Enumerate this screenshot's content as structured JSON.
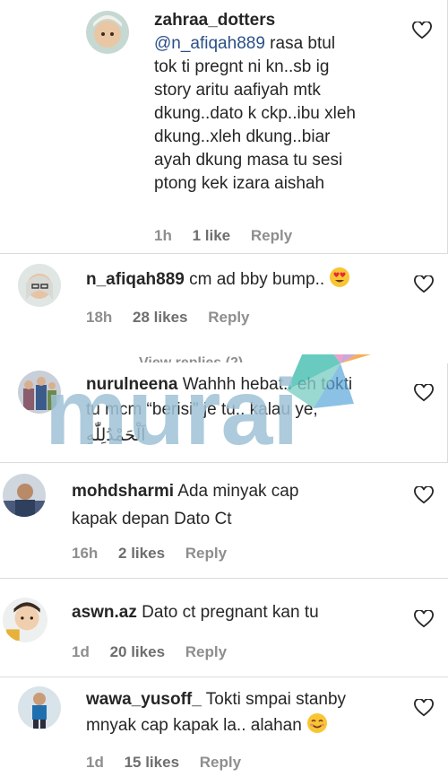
{
  "comments": [
    {
      "username": "zahraa_dotters",
      "mention": "@n_afiqah889",
      "lines": [
        "rasa btul",
        "tok ti pregnt ni kn..sb ig",
        "story aritu aafiyah mtk",
        "dkung..dato k ckp..ibu xleh",
        "dkung..xleh dkung..biar",
        "ayah dkung masa tu sesi",
        "ptong kek izara aishah"
      ],
      "time": "1h",
      "likes": "1 like",
      "reply": "Reply"
    },
    {
      "username": "n_afiqah889",
      "text": "cm ad bby bump..",
      "emoji": "heart-eyes-emoji",
      "time": "18h",
      "likes": "28 likes",
      "reply": "Reply",
      "view_replies": "View replies (2)"
    },
    {
      "username": "nurulneena",
      "text_line1": "Wahhh hebat.. eh tokti",
      "text_line2": "tu mcm “berisi” je tu.. kalau ye,",
      "text_line3": "اَلْحَمْدُلِلّٰهِ"
    },
    {
      "username": "mohdsharmi",
      "text_line1": "Ada minyak cap",
      "text_line2": "kapak depan Dato Ct",
      "time": "16h",
      "likes": "2 likes",
      "reply": "Reply"
    },
    {
      "username": "aswn.az",
      "text": "Dato ct pregnant kan tu",
      "time": "1d",
      "likes": "20 likes",
      "reply": "Reply"
    },
    {
      "username": "wawa_yusoff_",
      "text_line1": "Tokti smpai stanby",
      "text_line2": "mnyak cap kapak la.. alahan",
      "emoji": "smiling-emoji",
      "time": "1d",
      "likes": "15 likes",
      "reply": "Reply"
    }
  ],
  "watermark": {
    "text": "murai",
    "colors": {
      "text": "#9fc3d6",
      "bird_teal": "#4fc1b5",
      "bird_pink": "#e889b8",
      "bird_orange": "#f4a13a"
    }
  },
  "colors": {
    "text": "#262626",
    "meta": "#8e8e8e",
    "mention": "#2b4f87",
    "divider": "#dcdcdc"
  }
}
